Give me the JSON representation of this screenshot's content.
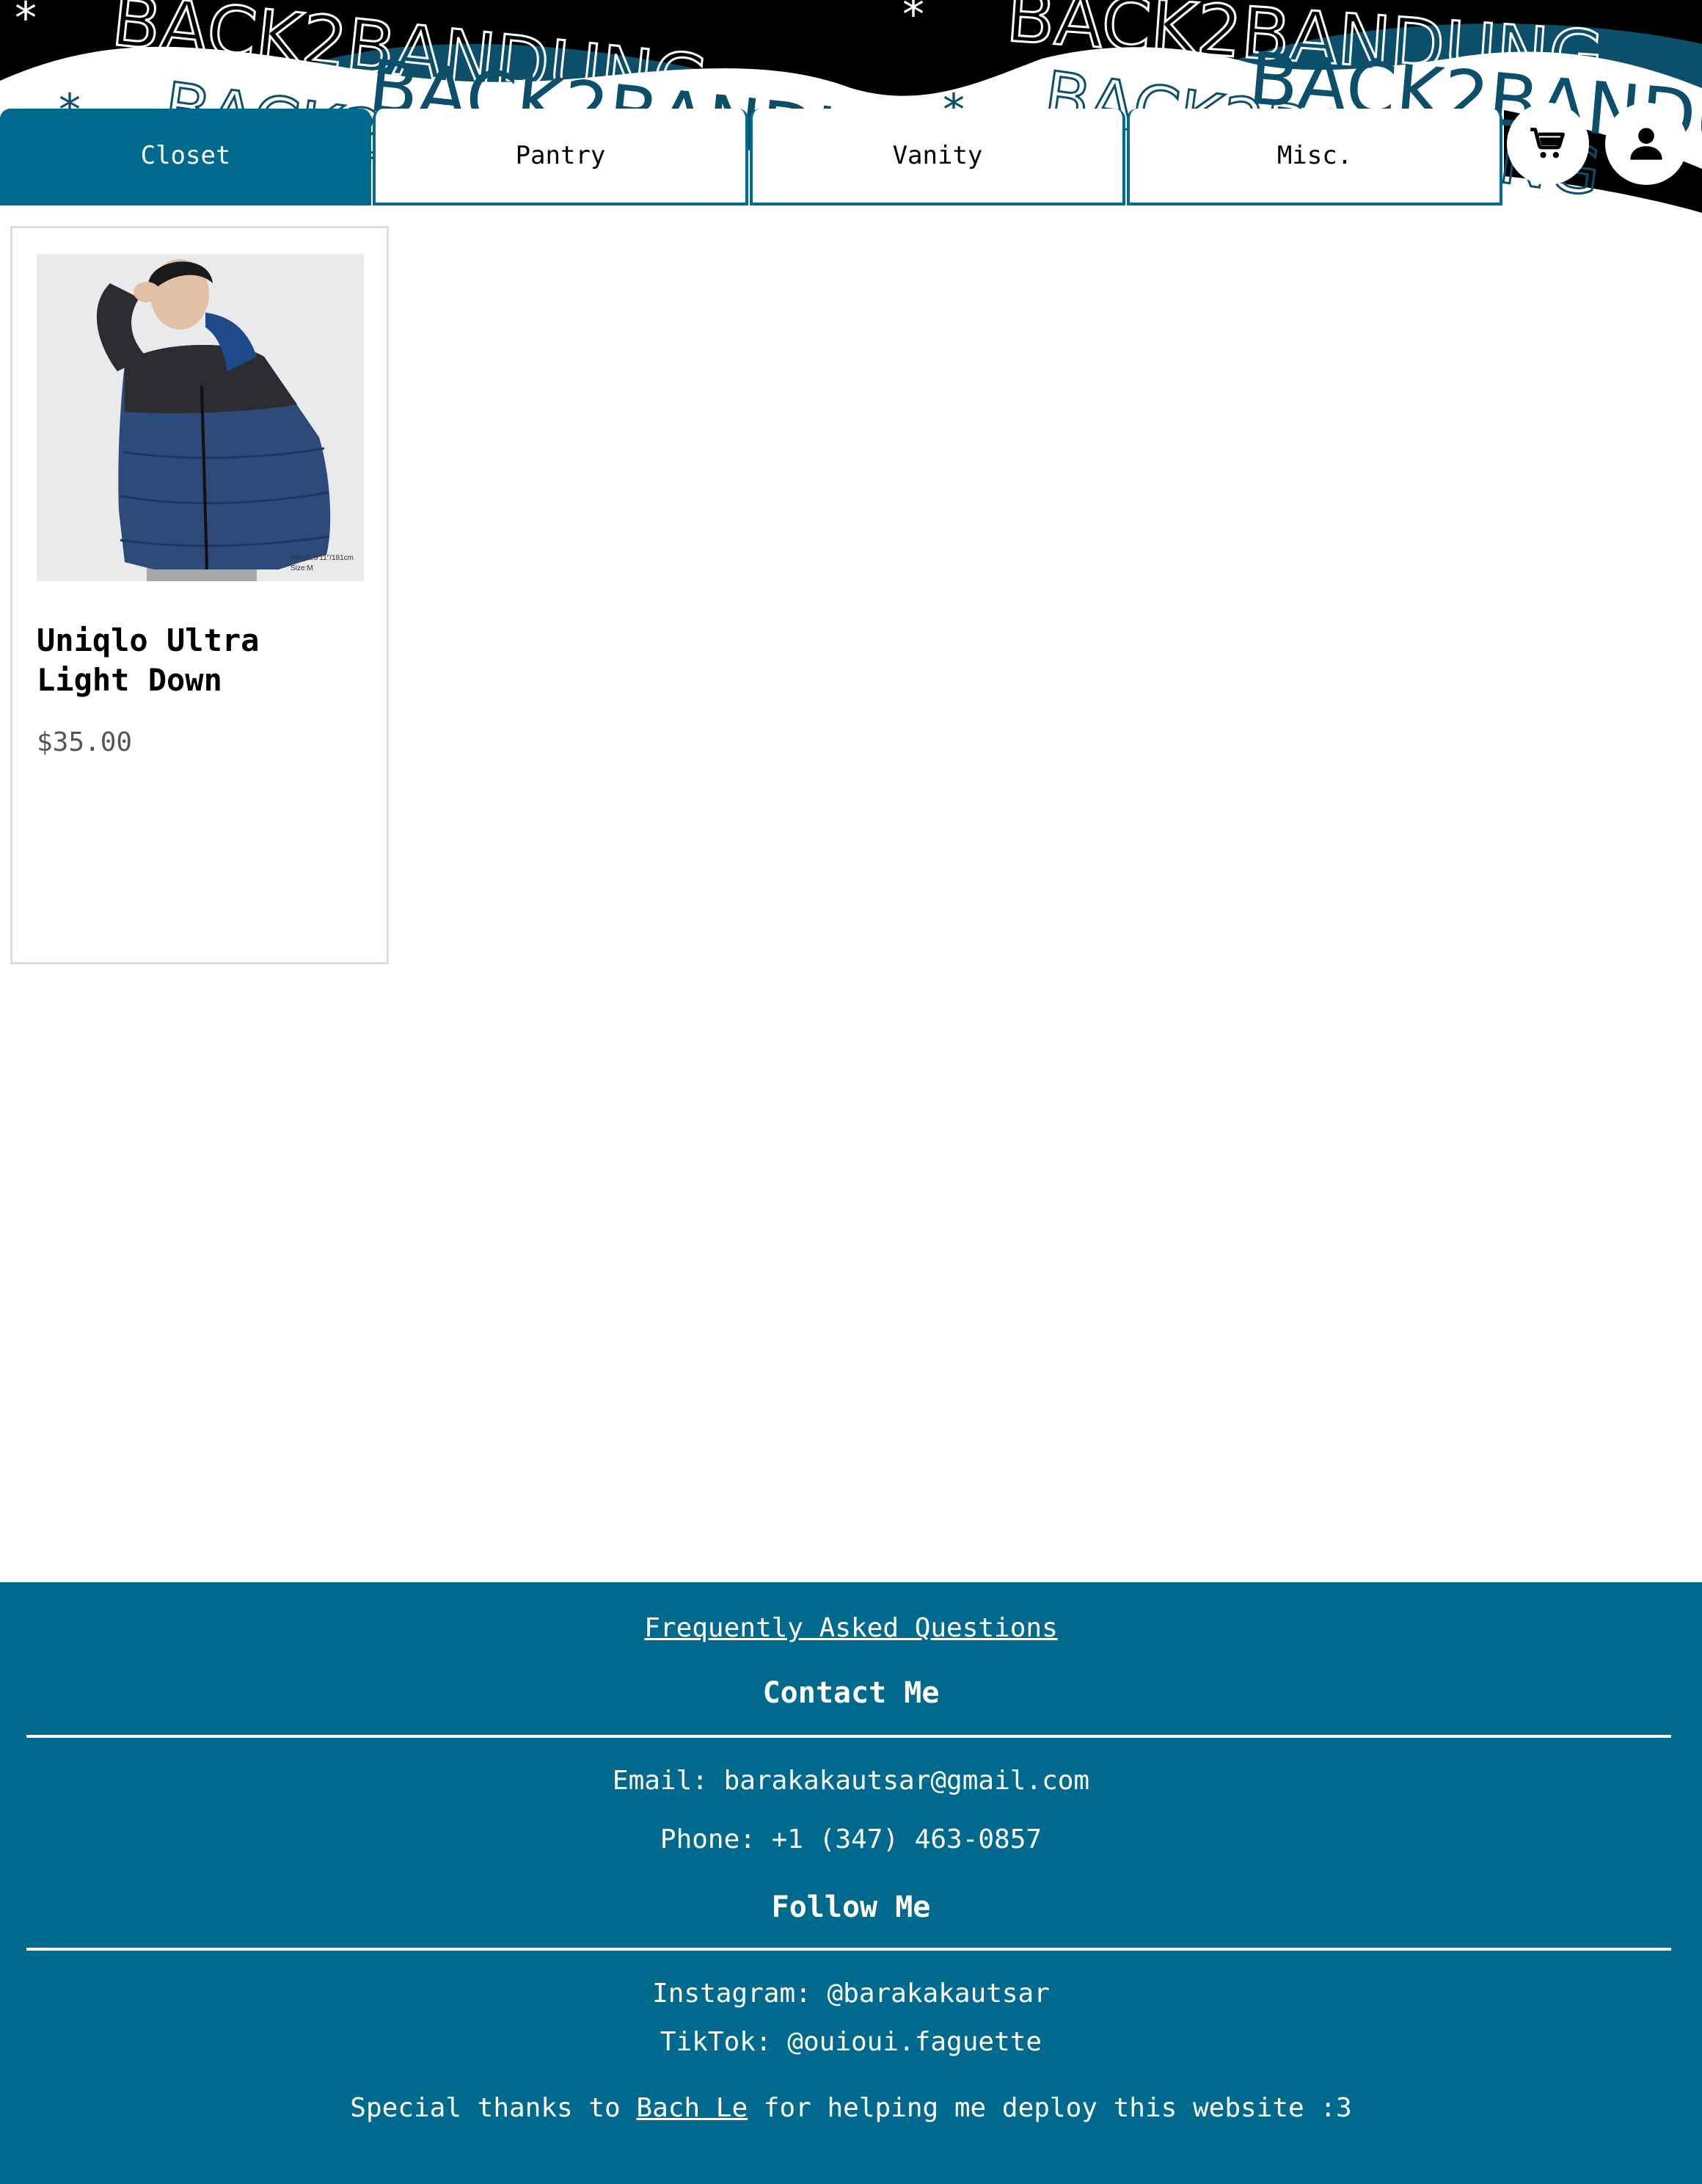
{
  "banner": {
    "text": "BACK2BANDUNG",
    "star": "*"
  },
  "tabs": [
    {
      "label": "Closet",
      "active": true
    },
    {
      "label": "Pantry",
      "active": false
    },
    {
      "label": "Vanity",
      "active": false
    },
    {
      "label": "Misc.",
      "active": false
    }
  ],
  "icons": {
    "cart": "cart-icon",
    "account": "user-icon"
  },
  "colors": {
    "accent": "#006a8e",
    "price": "#555555"
  },
  "product": {
    "name": "Uniqlo Ultra Light Down",
    "price": "$35.00",
    "photo_caption_height": "Height:5'11\"/181cm",
    "photo_caption_size": "Size:M"
  },
  "footer": {
    "faq_link": "Frequently Asked Questions",
    "contact_heading": "Contact Me",
    "email": "Email: barakakautsar@gmail.com",
    "phone": "Phone: +1 (347) 463-0857",
    "follow_heading": "Follow Me",
    "instagram": "Instagram: @barakakautsar",
    "tiktok": "TikTok: @ouioui.faguette",
    "thanks_prefix": "Special thanks to ",
    "thanks_link": "Bach Le",
    "thanks_suffix": " for helping me deploy this website :3"
  }
}
